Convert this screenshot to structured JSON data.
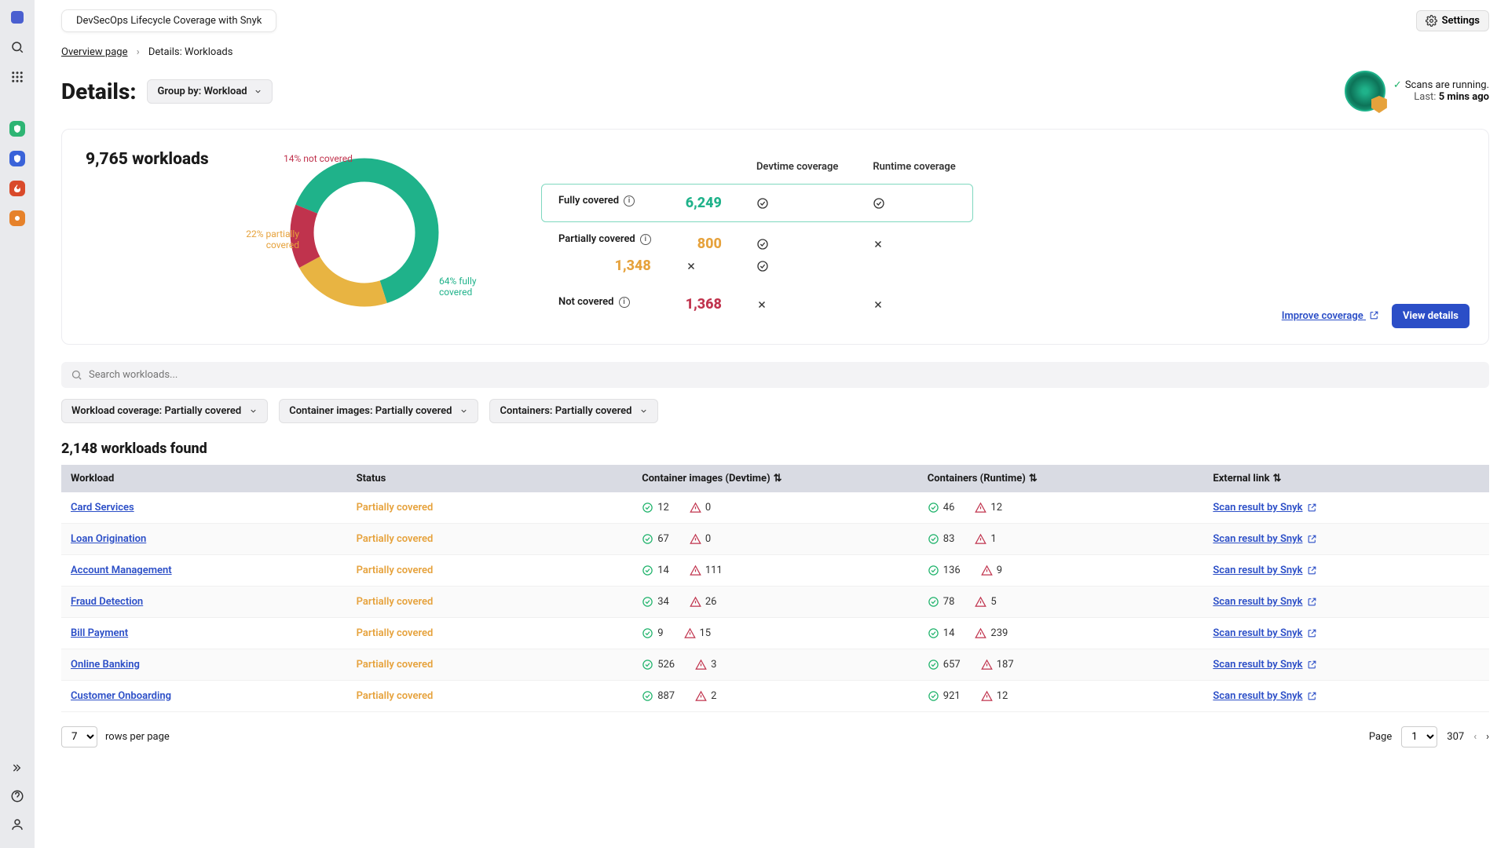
{
  "topbar": {
    "pill": "DevSecOps Lifecycle Coverage with Snyk",
    "settings": "Settings"
  },
  "breadcrumb": {
    "parent": "Overview page",
    "current": "Details: Workloads"
  },
  "header": {
    "title": "Details:",
    "groupby_label": "Group by: Workload"
  },
  "scan": {
    "running": "Scans are running.",
    "last_label": "Last:",
    "last_value": "5 mins ago"
  },
  "chart_data": {
    "type": "pie",
    "title": "9,765 workloads",
    "series": [
      {
        "name": "fully covered",
        "value": 64,
        "color": "#1fb28a"
      },
      {
        "name": "partially covered",
        "value": 22,
        "color": "#e8b442"
      },
      {
        "name": "not covered",
        "value": 14,
        "color": "#c0334d"
      }
    ],
    "labels": {
      "not_covered": "14% not covered",
      "partially": "22% partially covered",
      "fully": "64% fully covered"
    }
  },
  "coverage": {
    "col_dev": "Devtime coverage",
    "col_run": "Runtime coverage",
    "fully": {
      "label": "Fully covered",
      "count": "6,249",
      "dev": "ok",
      "run": "ok"
    },
    "partial": {
      "label": "Partially covered",
      "count1": "800",
      "count2": "1,348",
      "dev1": "ok",
      "run1": "x",
      "dev2": "x",
      "run2": "ok"
    },
    "notc": {
      "label": "Not covered",
      "count": "1,368",
      "dev": "x",
      "run": "x"
    },
    "improve": "Improve coverage",
    "view_details": "View details"
  },
  "search": {
    "placeholder": "Search workloads..."
  },
  "filters": [
    "Workload coverage: Partially covered",
    "Container images: Partially covered",
    "Containers: Partially covered"
  ],
  "results": {
    "title": "2,148 workloads found"
  },
  "columns": {
    "workload": "Workload",
    "status": "Status",
    "images": "Container images (Devtime)",
    "containers": "Containers (Runtime)",
    "external": "External link"
  },
  "rows": [
    {
      "name": "Card Services",
      "status": "Partially covered",
      "img_ok": "12",
      "img_warn": "0",
      "ctr_ok": "46",
      "ctr_warn": "12",
      "ext": "Scan result by Snyk"
    },
    {
      "name": "Loan Origination",
      "status": "Partially covered",
      "img_ok": "67",
      "img_warn": "0",
      "ctr_ok": "83",
      "ctr_warn": "1",
      "ext": "Scan result by Snyk"
    },
    {
      "name": "Account Management",
      "status": "Partially covered",
      "img_ok": "14",
      "img_warn": "111",
      "ctr_ok": "136",
      "ctr_warn": "9",
      "ext": "Scan result by Snyk"
    },
    {
      "name": "Fraud Detection",
      "status": "Partially covered",
      "img_ok": "34",
      "img_warn": "26",
      "ctr_ok": "78",
      "ctr_warn": "5",
      "ext": "Scan result by Snyk"
    },
    {
      "name": "Bill Payment",
      "status": "Partially covered",
      "img_ok": "9",
      "img_warn": "15",
      "ctr_ok": "14",
      "ctr_warn": "239",
      "ext": "Scan result by Snyk"
    },
    {
      "name": "Online Banking",
      "status": "Partially covered",
      "img_ok": "526",
      "img_warn": "3",
      "ctr_ok": "657",
      "ctr_warn": "187",
      "ext": "Scan result by Snyk"
    },
    {
      "name": "Customer Onboarding",
      "status": "Partially covered",
      "img_ok": "887",
      "img_warn": "2",
      "ctr_ok": "921",
      "ctr_warn": "12",
      "ext": "Scan result by Snyk"
    }
  ],
  "pager": {
    "rows_per_page": "7",
    "rows_label": "rows per page",
    "page_label": "Page",
    "page": "1",
    "total": "307"
  }
}
